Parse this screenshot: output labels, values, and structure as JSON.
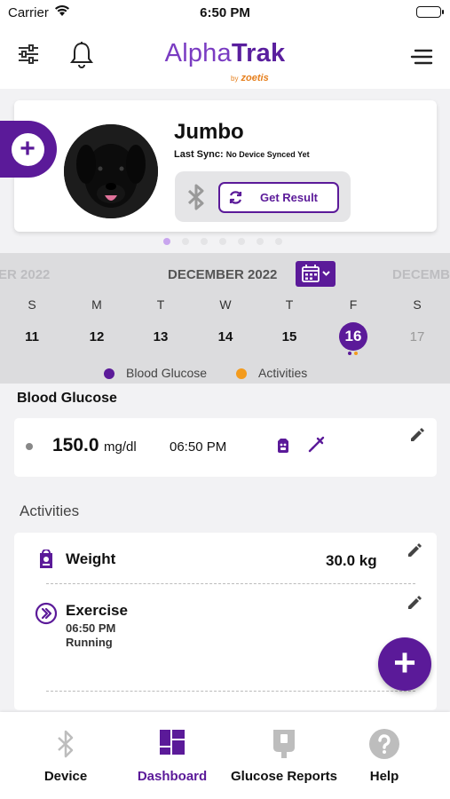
{
  "status_bar": {
    "carrier": "Carrier",
    "time": "6:50 PM"
  },
  "header": {
    "brand_alpha": "Alpha",
    "brand_trak": "Trak",
    "brand_by": "by",
    "brand_sub": "zoetis",
    "icons": [
      "filter-icon",
      "bell-icon",
      "menu-icon"
    ]
  },
  "pet": {
    "name": "Jumbo",
    "last_sync_label": "Last Sync:",
    "last_sync_value": "No Device Synced Yet",
    "get_result_label": "Get Result"
  },
  "calendar": {
    "month": "DECEMBER 2022",
    "prev_month": "ER 2022",
    "next_month": "DECEMB",
    "weekdays": [
      "S",
      "M",
      "T",
      "W",
      "T",
      "F",
      "S"
    ],
    "days": [
      "11",
      "12",
      "13",
      "14",
      "15",
      "16",
      "17"
    ],
    "selected_day": "16",
    "legend": [
      {
        "label": "Blood Glucose",
        "color": "#5b1a99"
      },
      {
        "label": "Activities",
        "color": "#f39b1d"
      }
    ]
  },
  "blood_glucose": {
    "title": "Blood Glucose",
    "value": "150.0",
    "unit": "mg/dl",
    "time": "06:50 PM"
  },
  "activities": {
    "title": "Activities",
    "weight": {
      "label": "Weight",
      "value": "30.0 kg"
    },
    "exercise": {
      "label": "Exercise",
      "time": "06:50 PM",
      "type": "Running"
    }
  },
  "tabbar": {
    "device": "Device",
    "dashboard": "Dashboard",
    "reports": "Glucose Reports",
    "help": "Help"
  },
  "colors": {
    "accent": "#5b1a99",
    "orange": "#f39b1d"
  }
}
